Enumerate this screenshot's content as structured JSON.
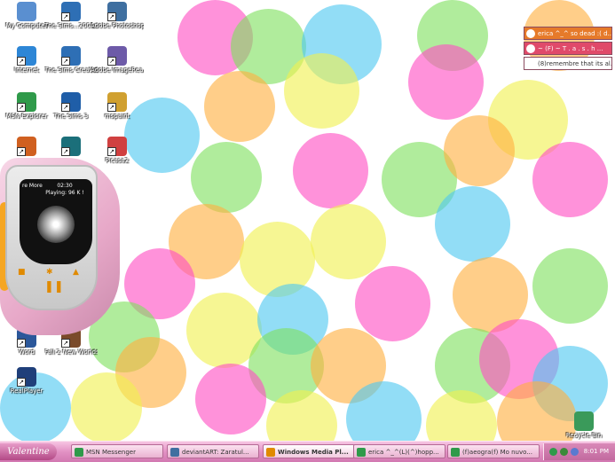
{
  "desktop_icons": [
    {
      "id": "my-computer",
      "label": "My Computer",
      "color": "#5a8fd0"
    },
    {
      "id": "sims-2001",
      "label": "The Sims...2001...",
      "color": "#2e6fb5"
    },
    {
      "id": "photoshop",
      "label": "Adobe Photoshop 7.0",
      "color": "#3f6fa0"
    },
    {
      "id": "internet",
      "label": "Internet",
      "color": "#2d86d6"
    },
    {
      "id": "sims-creator",
      "label": "The Sims Creator",
      "color": "#2e6fb5"
    },
    {
      "id": "imageready",
      "label": "Adobe ImageRea...",
      "color": "#6d5aa8"
    },
    {
      "id": "msn-explorer",
      "label": "MSN Explorer",
      "color": "#2f9a4a"
    },
    {
      "id": "sims-3",
      "label": "The Sims 3",
      "color": "#1f5ea8"
    },
    {
      "id": "mspaint",
      "label": "mspaint",
      "color": "#d0a030"
    },
    {
      "id": "icon-4a",
      "label": "",
      "color": "#d06020"
    },
    {
      "id": "icon-4b",
      "label": "",
      "color": "#1b6f7a"
    },
    {
      "id": "picasa",
      "label": "Picasa2",
      "color": "#d04040"
    },
    {
      "id": "word",
      "label": "Word",
      "color": "#2b579a"
    },
    {
      "id": "fall-new-worlds",
      "label": "Fall 2 New Worlds",
      "color": "#7a4a2a"
    },
    {
      "id": "realplayer",
      "label": "RealPlayer",
      "color": "#1f3f7a"
    },
    {
      "id": "recycle-bin",
      "label": "Recycle Bin",
      "color": "#3a9a5a"
    }
  ],
  "media_player": {
    "more_label": "re More",
    "time": "02:30",
    "status": "Playing: 96 K !"
  },
  "conversations": [
    {
      "text": "erica ^_^ so dead :( d...",
      "color": "#e67a2a"
    },
    {
      "text": "~ (F) ~  T . a . s . h ...",
      "color": "#e04a6a"
    },
    {
      "text": "(8)remembre that its al...",
      "color": "#ffffff",
      "textcolor": "#333333"
    }
  ],
  "taskbar": {
    "start_label": "Valentine",
    "buttons": [
      {
        "label": "MSN Messenger",
        "active": false,
        "color": "#2f9a4a"
      },
      {
        "label": "deviantART: Zaratul...",
        "active": false,
        "color": "#3f6fa0"
      },
      {
        "label": "Windows Media Pl...",
        "active": true,
        "color": "#e08a00"
      },
      {
        "label": "erica ^_^(L)(^)hopp...",
        "active": false,
        "color": "#2f9a4a"
      },
      {
        "label": "(f)aeogra(f) Mo nuvo...",
        "active": false,
        "color": "#2f9a4a"
      }
    ],
    "clock": "8:01 PM"
  },
  "colors": {
    "pink": "#ff4fc4",
    "blue": "#4fc8f0",
    "yellow": "#f0f050",
    "green": "#7fe060",
    "orange": "#ffb040"
  }
}
